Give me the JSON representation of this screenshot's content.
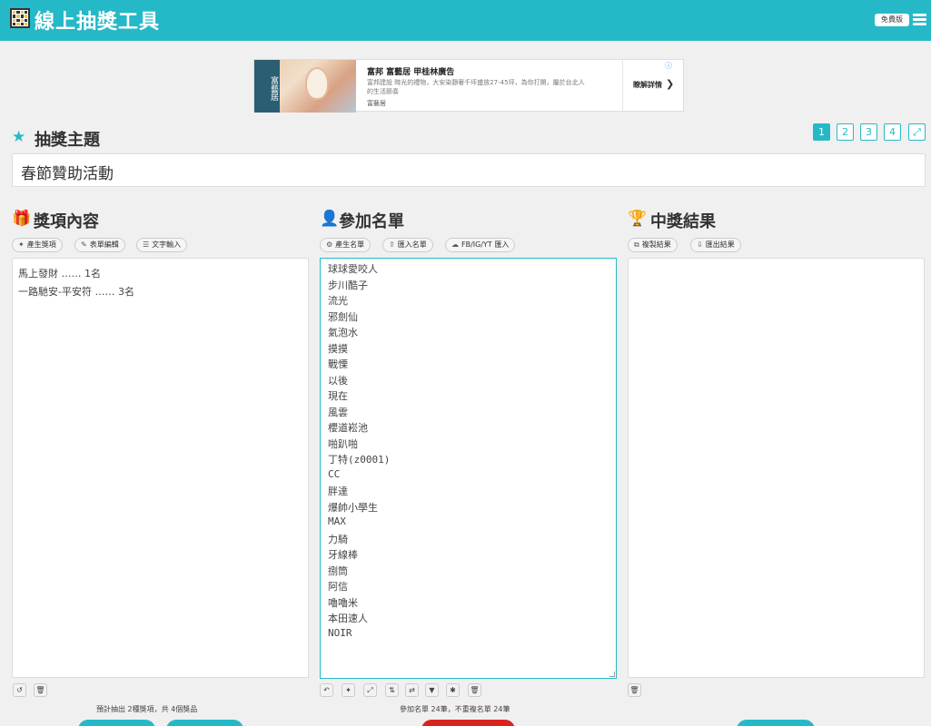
{
  "app": {
    "title": "線上抽獎工具",
    "free_badge": "免費版"
  },
  "ad": {
    "banner_text": "富藝居",
    "title": "富邦 富藝居 甲桂林廣告",
    "desc": "富邦建設 時光的禮物，大安染靜奢千坪盛放27-45坪，為你打開，屬於台北人的生活節奏",
    "brand": "富藝居",
    "cta": "瞭解詳情"
  },
  "theme": {
    "heading": "抽獎主題",
    "value": "春節贊助活動"
  },
  "pages": [
    "1",
    "2",
    "3",
    "4"
  ],
  "prizes": {
    "heading": "獎項內容",
    "buttons": [
      "產生獎項",
      "表單編輯",
      "文字輸入"
    ],
    "items": [
      "馬上發財 …… 1名",
      "一路馳安-平安符 …… 3名"
    ],
    "stat": "預計抽出 2種獎項，共 4個獎品"
  },
  "participants": {
    "heading": "參加名單",
    "buttons": [
      "產生名單",
      "匯入名單",
      "FB/IG/YT 匯入"
    ],
    "names": [
      "球球愛咬人",
      "步川酷子",
      "流光",
      "邪劍仙",
      "氣泡水",
      "摸摸",
      "戰慄",
      "以後",
      "現在",
      "風雲",
      "櫻道崧池",
      "啪趴啪",
      "丁特(z0001)",
      "CC",
      "胖達",
      "爆帥小學生",
      "MAX",
      "力騎",
      "牙線棒",
      "捌筒",
      "阿信",
      "嚕嚕米",
      "本田速人",
      "NOIR"
    ],
    "stat": "參加名單 24筆，不重複名單 24筆"
  },
  "results": {
    "heading": "中獎結果",
    "buttons": [
      "複製結果",
      "匯出結果"
    ]
  },
  "colors": {
    "accent": "#25b9c8",
    "primary_action": "#d9231f"
  }
}
